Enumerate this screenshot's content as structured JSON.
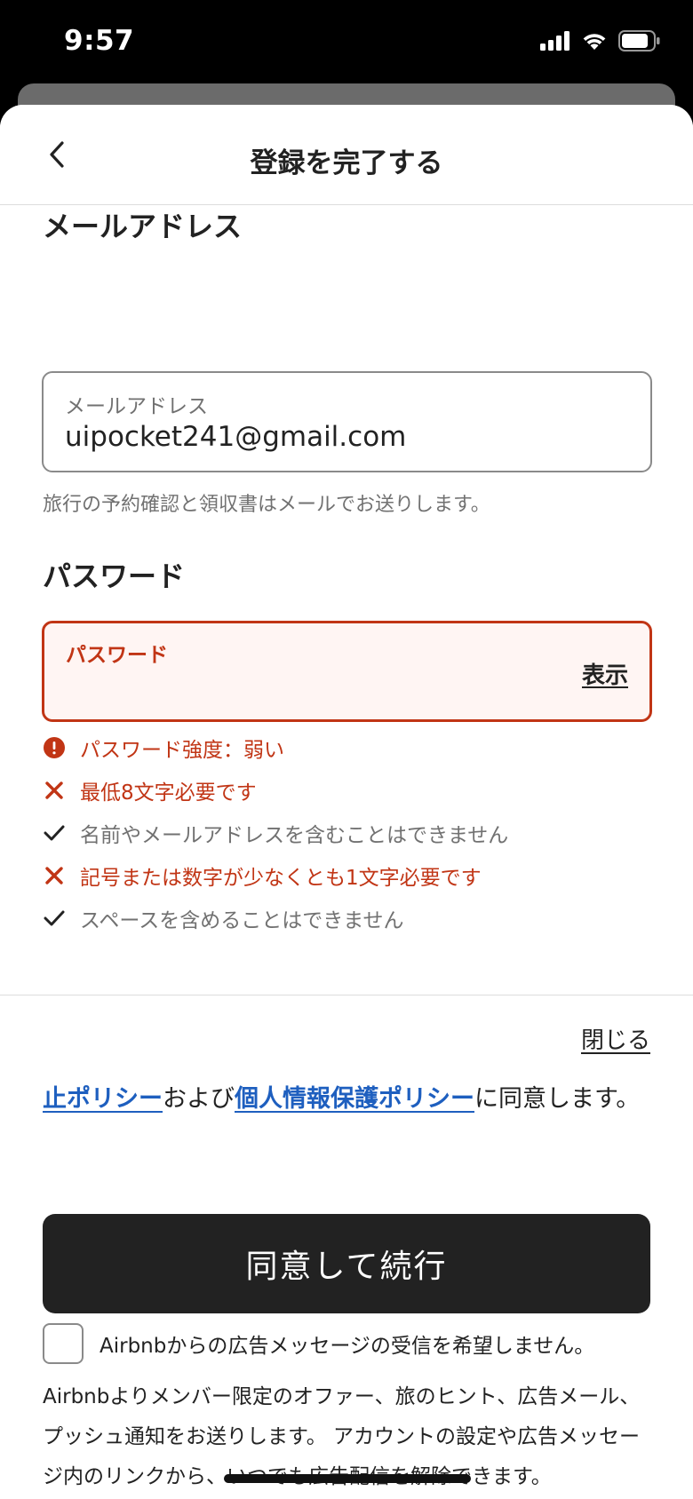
{
  "status_bar": {
    "time": "9:57"
  },
  "header": {
    "title": "登録を完了する"
  },
  "email_section": {
    "heading": "メールアドレス",
    "field_label": "メールアドレス",
    "field_value": "uipocket241@gmail.com",
    "helper": "旅行の予約確認と領収書はメールでお送りします。"
  },
  "password_section": {
    "heading": "パスワード",
    "field_label": "パスワード",
    "show_label": "表示",
    "rules": [
      {
        "text": "パスワード強度：弱い",
        "status": "alert"
      },
      {
        "text": "最低8文字必要です",
        "status": "fail"
      },
      {
        "text": "名前やメールアドレスを含むことはできません",
        "status": "pass"
      },
      {
        "text": "記号または数字が少なくとも1文字必要です",
        "status": "fail"
      },
      {
        "text": "スペースを含めることはできません",
        "status": "pass"
      }
    ]
  },
  "overlay": {
    "close_label": "閉じる",
    "policy": {
      "link1": "止ポリシー",
      "text1": "および",
      "link2": "個人情報保護ポリシー",
      "text2": "に同意します。"
    },
    "agree_button": "同意して続行",
    "marketing_text": "Airbnbよりメンバー限定のオファー、旅のヒント、広告メール、プッシュ通知をお送りします。 アカウントの設定や広告メッセージ内のリンクから、いつでも広告配信を解除できます。",
    "optout_label": "Airbnbからの広告メッセージの受信を希望しません。"
  },
  "colors": {
    "error": "#c13515",
    "link": "#1e5fbf",
    "button": "#222222",
    "muted": "#717171"
  }
}
